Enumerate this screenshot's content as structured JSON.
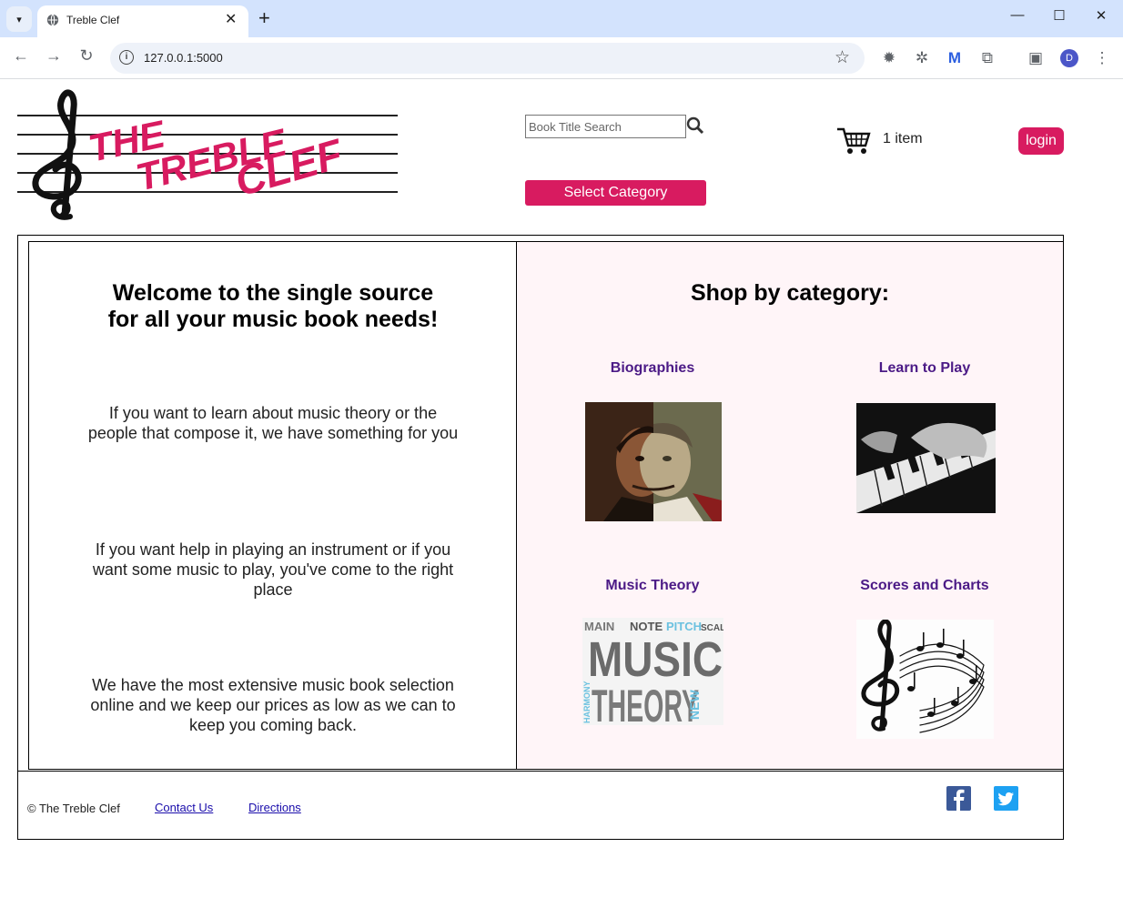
{
  "browser": {
    "tab_title": "Treble Clef",
    "url": "127.0.0.1:5000",
    "profile_initial": "D"
  },
  "header": {
    "logo_text": [
      "THE",
      "TREBLE",
      "CLEF"
    ],
    "search_placeholder": "Book Title Search",
    "category_button": "Select Category",
    "cart_count": "1 item",
    "login_label": "login"
  },
  "welcome": {
    "heading_line1": "Welcome to the single source",
    "heading_line2": "for all your music book needs!",
    "paragraphs": [
      "If you want to learn about music theory or the people that compose it, we have something for you",
      "If you want help in playing an instrument or if you want some music to play, you've come to the right place",
      "We have the most extensive music book selection online and we keep our prices as low as we can to keep you coming back."
    ]
  },
  "shop": {
    "title": "Shop by category:",
    "categories": [
      {
        "label": "Biographies"
      },
      {
        "label": "Learn to Play"
      },
      {
        "label": "Music Theory"
      },
      {
        "label": "Scores and Charts"
      }
    ]
  },
  "footer": {
    "copyright": "© The Treble Clef",
    "contact": "Contact Us",
    "directions": "Directions"
  },
  "colors": {
    "brand_pink": "#d81b60",
    "category_purple": "#4b1a86",
    "panel_bg": "#fff5f8"
  }
}
